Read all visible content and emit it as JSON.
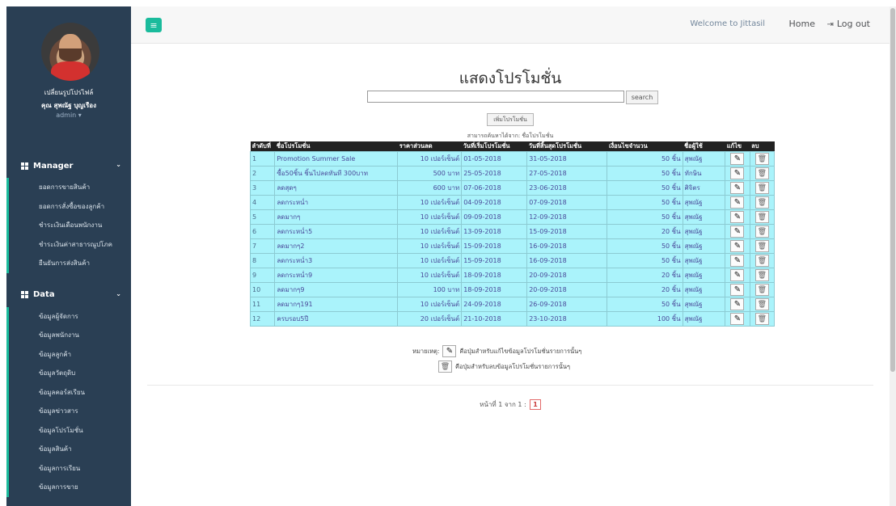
{
  "sidebar": {
    "change_profile": "เปลี่ยนรูปโปรไฟล์",
    "user_name": "คุณ สุพณัฐ บุญเรือง",
    "role": "admin ▾",
    "sections": [
      {
        "label": "Manager",
        "items": [
          "ยอดการขายสินค้า",
          "ยอดการสั่งซื้อของลูกค้า",
          "ชำระเงินเดือนพนักงาน",
          "ชำระเงินค่าสาธารณูปโภค",
          "ยืนยันการส่งสินค้า"
        ]
      },
      {
        "label": "Data",
        "items": [
          "ข้อมูลผู้จัดการ",
          "ข้อมูลพนักงาน",
          "ข้อมูลลูกค้า",
          "ข้อมูลวัตถุดิบ",
          "ข้อมูลคอร์สเรียน",
          "ข้อมูลข่าวสาร",
          "ข้อมูลโปรโมชั่น",
          "ข้อมูลสินค้า",
          "ข้อมูลการเรียน",
          "ข้อมูลการขาย"
        ]
      }
    ]
  },
  "topbar": {
    "toggle_icon": "≡",
    "welcome": "Welcome to Jittasil",
    "home": "Home",
    "logout": "Log out"
  },
  "main": {
    "title": "แสดงโปรโมชั่น",
    "search_button": "search",
    "add_button": "เพิ่มโปรโมชั่น",
    "search_hint": "สามารถค้นหาได้จาก: ชื่อโปรโมชั่น",
    "table": {
      "headers": [
        "ลำดับที่",
        "ชื่อโปรโมชั่น",
        "ราคาส่วนลด",
        "วันที่เริ่มโปรโมชั่น",
        "วันที่สิ้นสุดโปรโมชั่น",
        "เงื่อนไขจำนวน",
        "ชื่อผู้ใช้",
        "แก้ไข",
        "ลบ"
      ],
      "rows": [
        [
          "1",
          "Promotion Summer Sale",
          "10 เปอร์เซ็นต์",
          "01-05-2018",
          "31-05-2018",
          "50 ชิ้น",
          "สุพณัฐ"
        ],
        [
          "2",
          "ซื้อ50ชิ้น ชิ้นไปลดทันที 300บาท",
          "500 บาท",
          "25-05-2018",
          "27-05-2018",
          "50 ชิ้น",
          "ทักษิน"
        ],
        [
          "3",
          "ลดสุดๆ",
          "600 บาท",
          "07-06-2018",
          "23-06-2018",
          "50 ชิ้น",
          "ศิจิตร"
        ],
        [
          "4",
          "ลดกระหน่ำ",
          "10 เปอร์เซ็นต์",
          "04-09-2018",
          "07-09-2018",
          "50 ชิ้น",
          "สุพณัฐ"
        ],
        [
          "5",
          "ลดมากๆ",
          "10 เปอร์เซ็นต์",
          "09-09-2018",
          "12-09-2018",
          "50 ชิ้น",
          "สุพณัฐ"
        ],
        [
          "6",
          "ลดกระหน่ำ5",
          "10 เปอร์เซ็นต์",
          "13-09-2018",
          "15-09-2018",
          "20 ชิ้น",
          "สุพณัฐ"
        ],
        [
          "7",
          "ลดมากๆ2",
          "10 เปอร์เซ็นต์",
          "15-09-2018",
          "16-09-2018",
          "50 ชิ้น",
          "สุพณัฐ"
        ],
        [
          "8",
          "ลดกระหน่ำ3",
          "10 เปอร์เซ็นต์",
          "15-09-2018",
          "16-09-2018",
          "50 ชิ้น",
          "สุพณัฐ"
        ],
        [
          "9",
          "ลดกระหน่ำ9",
          "10 เปอร์เซ็นต์",
          "18-09-2018",
          "20-09-2018",
          "20 ชิ้น",
          "สุพณัฐ"
        ],
        [
          "10",
          "ลดมากๆ9",
          "100 บาท",
          "18-09-2018",
          "20-09-2018",
          "20 ชิ้น",
          "สุพณัฐ"
        ],
        [
          "11",
          "ลดมากๆ191",
          "10 เปอร์เซ็นต์",
          "24-09-2018",
          "26-09-2018",
          "50 ชิ้น",
          "สุพณัฐ"
        ],
        [
          "12",
          "ครบรอบ5ปี",
          "20 เปอร์เซ็นต์",
          "21-10-2018",
          "23-10-2018",
          "100 ชิ้น",
          "สุพณัฐ"
        ]
      ]
    },
    "note_label": "หมายเหตุ:",
    "edit_note": "คือปุ่มสำหรับแก้ไขข้อมูลโปรโมชั่นรายการนั้นๆ",
    "delete_note": "คือปุ่มสำหรับลบข้อมูลโปรโมชั่นรายการนั้นๆ",
    "pager_text": "หน้าที่ 1 จาก 1 :",
    "current_page": "1"
  },
  "icons": {
    "edit": "pencil-icon",
    "delete": "trash-icon",
    "logout": "sign-out-icon",
    "menu": "bars-icon",
    "section": "grid-icon"
  },
  "colors": {
    "sidebar_bg": "#2a3f54",
    "accent": "#1abb9c",
    "row_bg": "#aaf3fb",
    "header_bg": "#222222"
  }
}
